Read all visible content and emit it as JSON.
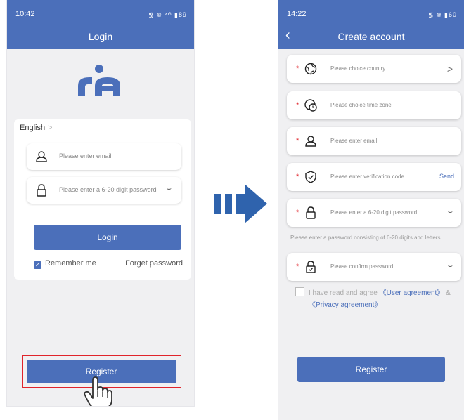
{
  "colors": {
    "accent": "#4b6fba",
    "highlight": "#e0242b",
    "required": "#e0242b"
  },
  "login_screen": {
    "status": {
      "time": "10:42",
      "icons_text": "᯾ ᪤ ⁴ᴳ ▮89"
    },
    "title": "Login",
    "language": "English",
    "email_placeholder": "Please enter email",
    "password_placeholder": "Please enter a 6-20 digit password",
    "login_label": "Login",
    "remember_label": "Remember me",
    "forget_label": "Forget password",
    "register_label": "Register"
  },
  "create_screen": {
    "status": {
      "time": "14:22",
      "icons_text": "᯾ ᪤ ▮60"
    },
    "title": "Create account",
    "fields": [
      {
        "icon": "globe-icon",
        "placeholder": "Please choice country"
      },
      {
        "icon": "time-zone-icon",
        "placeholder": "Please choice time zone"
      },
      {
        "icon": "user-icon",
        "placeholder": "Please enter email"
      },
      {
        "icon": "shield-check-icon",
        "placeholder": "Please enter verification code",
        "action": "Send"
      },
      {
        "icon": "lock-icon",
        "placeholder": "Please enter a 6-20 digit password"
      },
      {
        "icon": "lock-check-icon",
        "placeholder": "Please confirm password"
      }
    ],
    "password_hint": "Please enter a password consisting of 6-20 digits and letters",
    "agree_text": "I have read and agree",
    "user_agreement": "《User agreement》",
    "amp": "&",
    "privacy_agreement": "《Privacy agreement》",
    "register_label": "Register"
  }
}
